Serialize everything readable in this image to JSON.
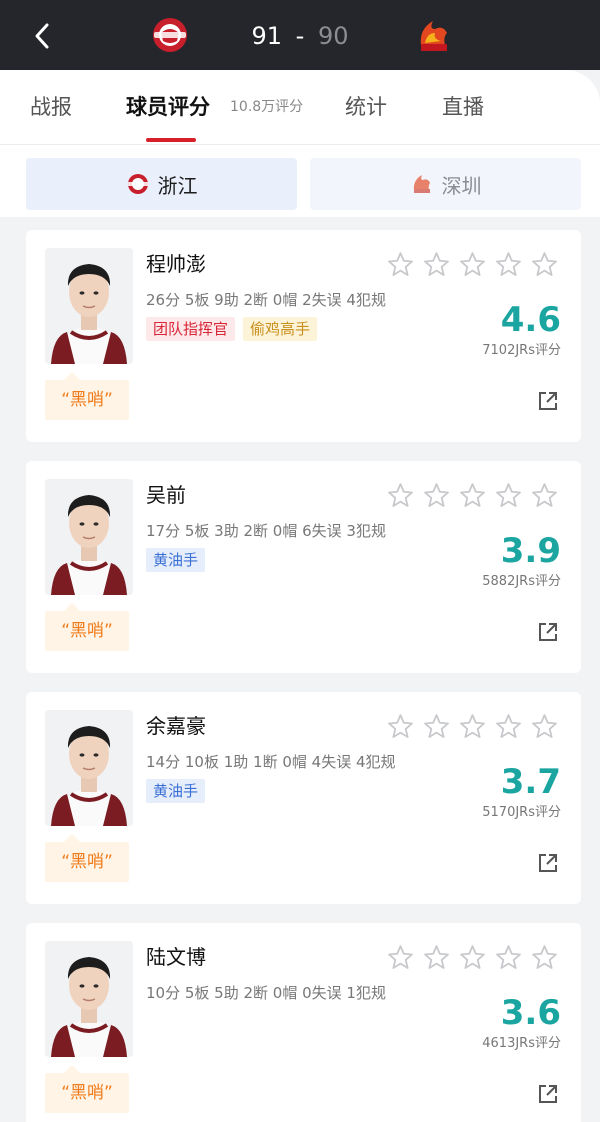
{
  "header": {
    "home_score": "91",
    "separator": "-",
    "away_score": "90",
    "home_logo_icon": "guangsha-lions-logo",
    "away_logo_icon": "shenzhen-leopards-logo",
    "colors": {
      "bar": "#25262b",
      "home_score": "#ffffff",
      "away_score": "#8c8d92"
    }
  },
  "tabs": [
    {
      "label": "战报",
      "active": false
    },
    {
      "label": "球员评分",
      "active": true,
      "sub": "10.8万评分"
    },
    {
      "label": "统计",
      "active": false
    },
    {
      "label": "直播",
      "active": false
    }
  ],
  "teams": [
    {
      "label": "浙江",
      "selected": true,
      "icon": "zhejiang-team-icon"
    },
    {
      "label": "深圳",
      "selected": false,
      "icon": "shenzhen-team-icon"
    }
  ],
  "players": [
    {
      "name": "程帅澎",
      "stats": "26分 5板 9助 2断 0帽 2失误 4犯规",
      "tags": [
        {
          "text": "团队指挥官",
          "style": "red"
        },
        {
          "text": "偷鸡高手",
          "style": "yellow"
        }
      ],
      "rating": "4.6",
      "count": "7102JRs评分",
      "stars": 0,
      "black_whistle": "“黑哨”"
    },
    {
      "name": "吴前",
      "stats": "17分 5板 3助 2断 0帽 6失误 3犯规",
      "tags": [
        {
          "text": "黄油手",
          "style": "blue"
        }
      ],
      "rating": "3.9",
      "count": "5882JRs评分",
      "stars": 0,
      "black_whistle": "“黑哨”"
    },
    {
      "name": "余嘉豪",
      "stats": "14分 10板 1助 1断 0帽 4失误 4犯规",
      "tags": [
        {
          "text": "黄油手",
          "style": "blue"
        }
      ],
      "rating": "3.7",
      "count": "5170JRs评分",
      "stars": 0,
      "black_whistle": "“黑哨”"
    },
    {
      "name": "陆文博",
      "stats": "10分 5板 5助 2断 0帽 0失误 1犯规",
      "tags": [],
      "rating": "3.6",
      "count": "4613JRs评分",
      "stars": 0,
      "black_whistle": "“黑哨”"
    }
  ],
  "accent": {
    "rating": "#1aa5a0",
    "tab_underline": "#d8202a",
    "whistle": "#f07b1a"
  }
}
